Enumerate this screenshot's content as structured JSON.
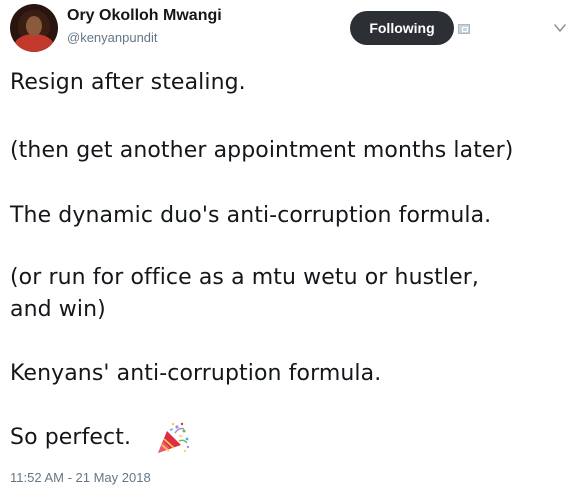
{
  "author": {
    "name": "Ory Okolloh Mwangi",
    "handle": "@kenyanpundit"
  },
  "follow_button": {
    "label": "Following"
  },
  "tweet": {
    "lines": [
      "Resign after stealing.",
      "(then get another appointment months later)",
      "The dynamic duo's anti-corruption formula.",
      "(or run for office as a mtu wetu or hustler,",
      "and win)",
      "Kenyans' anti-corruption formula.",
      "So perfect."
    ],
    "emoji": "party-popper-icon",
    "timestamp": "11:52 AM - 21 May 2018"
  },
  "colors": {
    "text": "#14171a",
    "secondary": "#657786",
    "button_bg": "#2c2f33",
    "button_text": "#ffffff"
  }
}
